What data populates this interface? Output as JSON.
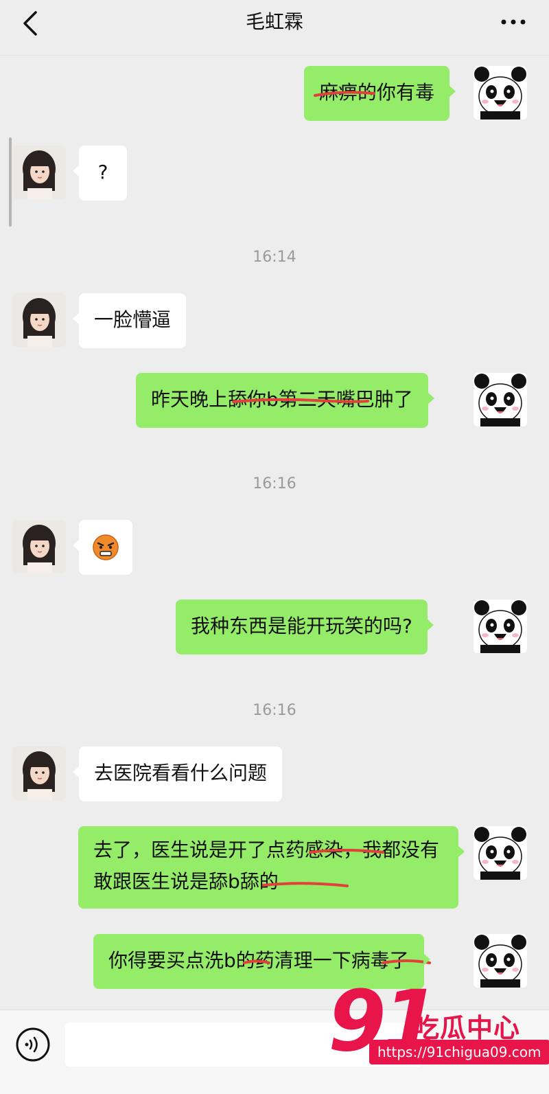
{
  "header": {
    "title": "毛虹霖"
  },
  "messages": [
    {
      "side": "out",
      "text": "麻痹的你有毒"
    },
    {
      "side": "in",
      "text": "?"
    },
    {
      "time": "16:14"
    },
    {
      "side": "in",
      "text": "一脸懵逼"
    },
    {
      "side": "out",
      "text": "昨天晚上舔你b第二天嘴巴肿了"
    },
    {
      "time": "16:16"
    },
    {
      "side": "in",
      "emoji": "angry-face-emoji"
    },
    {
      "side": "out",
      "text": "我种东西是能开玩笑的吗?"
    },
    {
      "time": "16:16"
    },
    {
      "side": "in",
      "text": "去医院看看什么问题"
    },
    {
      "side": "out",
      "text": "去了，医生说是开了点药感染，我都没有敢跟医生说是舔b舔的"
    },
    {
      "side": "out",
      "text": "你得要买点洗b的药清理一下病毒了"
    }
  ],
  "input_bar": {
    "placeholder": ""
  },
  "watermark": {
    "brand_number": "91",
    "brand_name": "吃瓜中心",
    "url": "https://91chigua09.com"
  },
  "colors": {
    "incoming_bubble": "#ffffff",
    "outgoing_bubble": "#95ec69",
    "background": "#ededed",
    "strike_red": "#e2403a"
  }
}
